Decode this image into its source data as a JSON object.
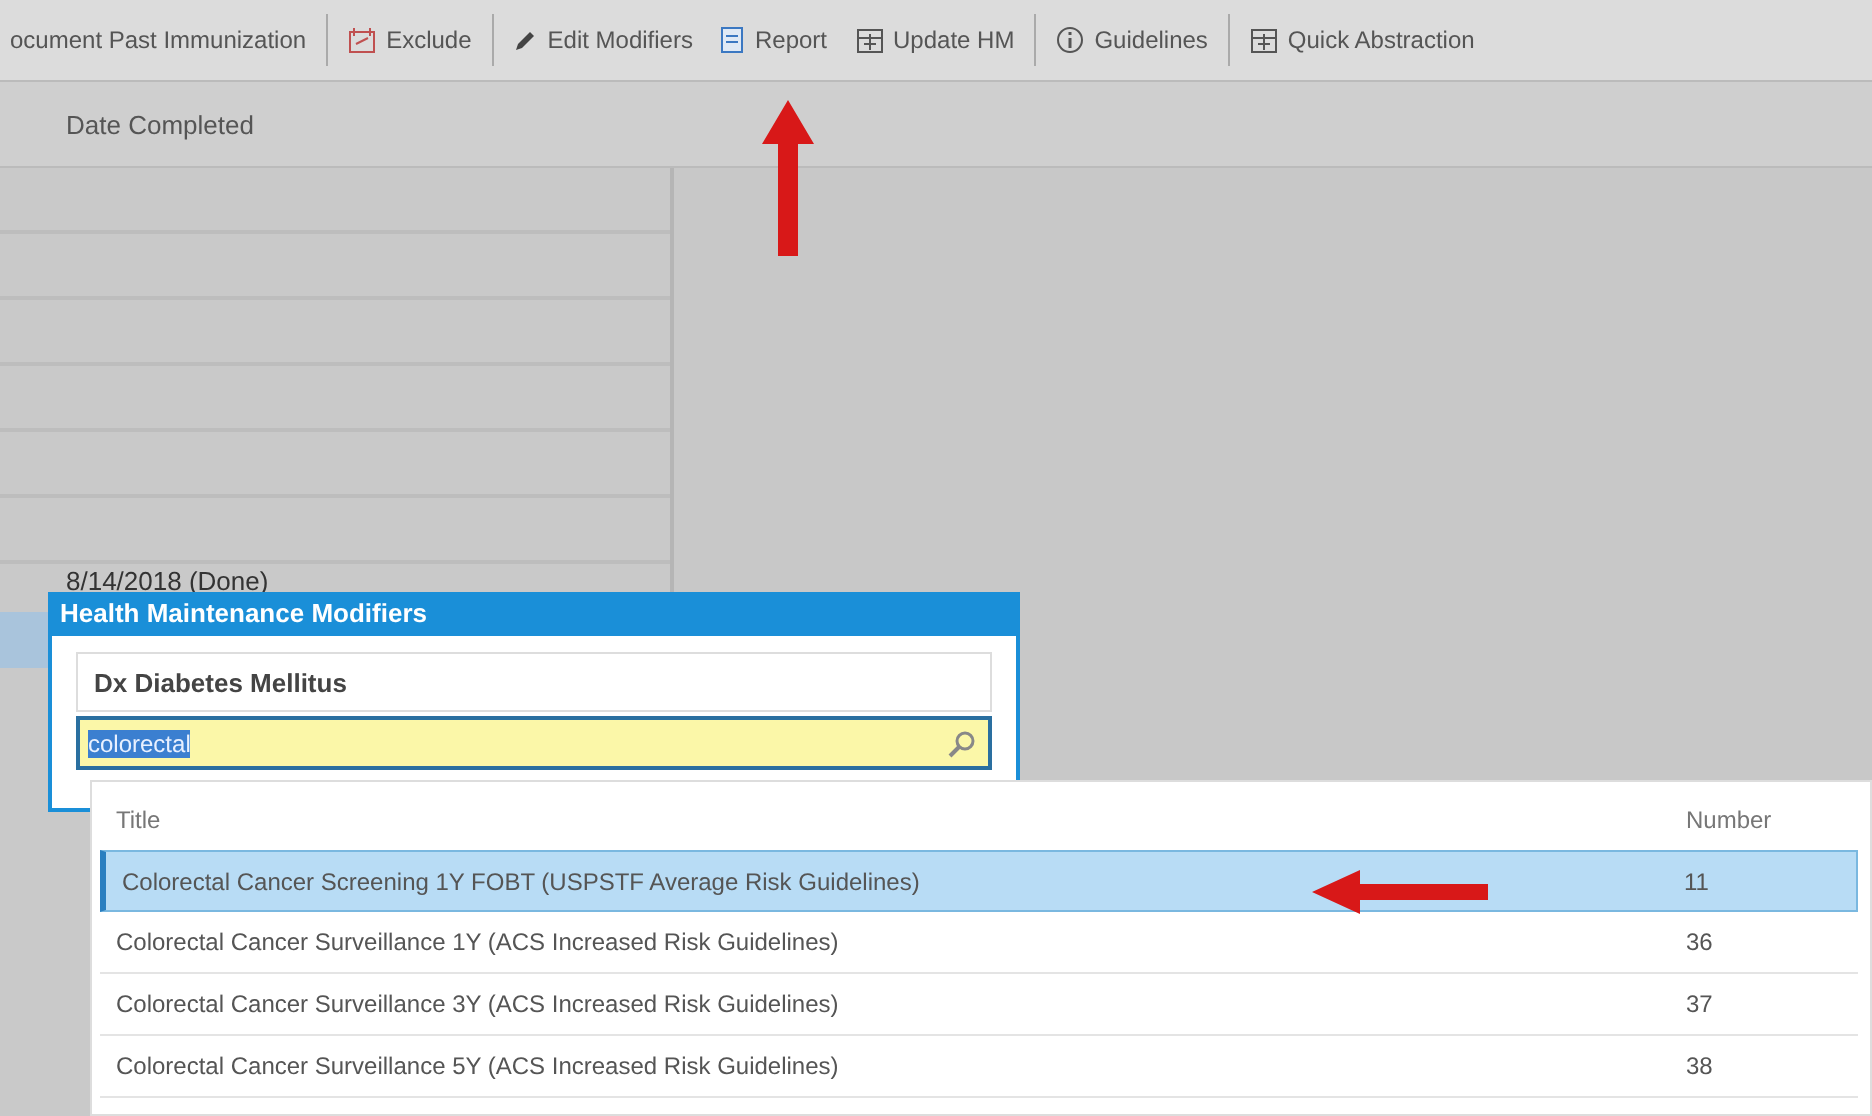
{
  "toolbar": [
    {
      "label": "ocument Past Immunization",
      "kind": "plain"
    },
    {
      "label": "Exclude",
      "kind": "calendar"
    },
    {
      "label": "Edit Modifiers",
      "kind": "pencil"
    },
    {
      "label": "Report",
      "kind": "document"
    },
    {
      "label": "Update HM",
      "kind": "box"
    },
    {
      "label": "Guidelines",
      "kind": "info"
    },
    {
      "label": "Quick Abstraction",
      "kind": "box"
    }
  ],
  "header": {
    "column": "Date Completed"
  },
  "rows": [
    "",
    "",
    "",
    "",
    "",
    "",
    "8/14/2018 (Done)"
  ],
  "dialog": {
    "title": "Health Maintenance Modifiers",
    "condition": "Dx Diabetes Mellitus",
    "search": {
      "value": "colorectal"
    }
  },
  "results": {
    "columns": [
      "Title",
      "Number"
    ],
    "rows": [
      {
        "title": "Colorectal Cancer Screening 1Y FOBT (USPSTF Average Risk Guidelines)",
        "number": "11",
        "selected": true
      },
      {
        "title": "Colorectal Cancer Surveillance 1Y (ACS Increased Risk Guidelines)",
        "number": "36",
        "selected": false
      },
      {
        "title": "Colorectal Cancer Surveillance 3Y (ACS Increased Risk Guidelines)",
        "number": "37",
        "selected": false
      },
      {
        "title": "Colorectal Cancer Surveillance 5Y (ACS Increased Risk Guidelines)",
        "number": "38",
        "selected": false
      }
    ]
  }
}
